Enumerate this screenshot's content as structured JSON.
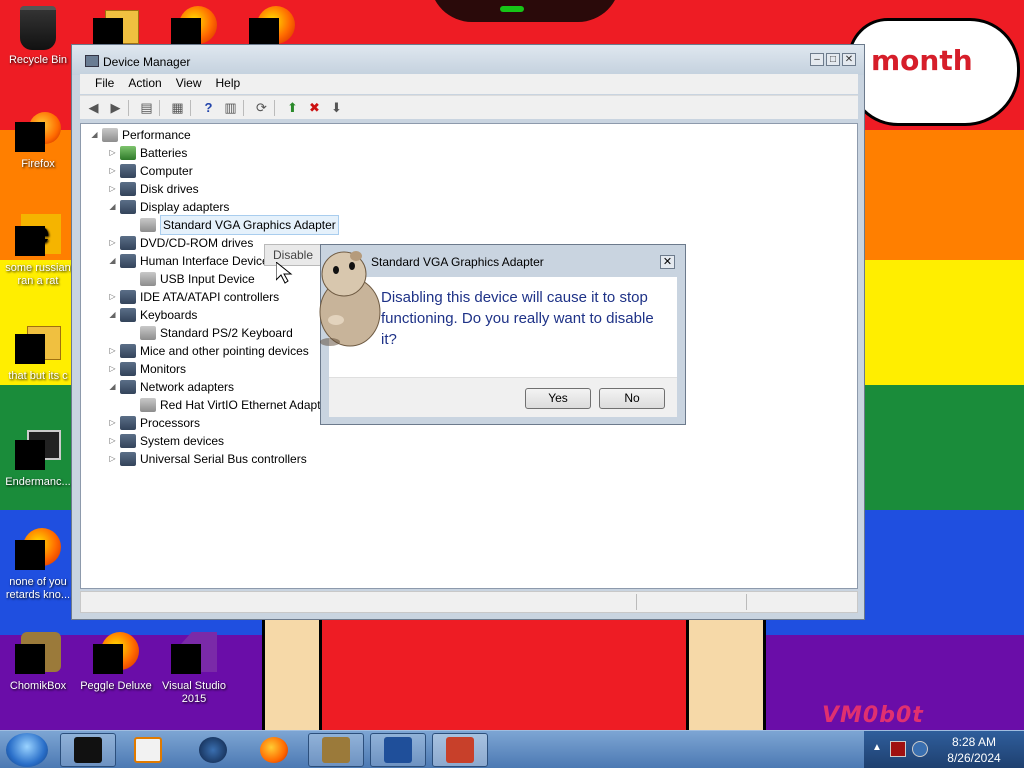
{
  "desktop": {
    "cloud_text": "month",
    "watermark": "VM0b0t",
    "icons": [
      {
        "label": "Recycle Bin",
        "icon": "recycle-bin-icon"
      },
      {
        "label": "Firefox",
        "icon": "firefox-icon"
      },
      {
        "label": "some russian ran a rat",
        "icon": "document-icon"
      },
      {
        "label": "that but its c",
        "icon": "folder-icon"
      },
      {
        "label": "Endermanc...",
        "icon": "app-icon"
      },
      {
        "label": "none of you retards kno...",
        "icon": "app-icon"
      },
      {
        "label": "ChomikBox",
        "icon": "chomikbox-icon"
      },
      {
        "label": "Peggle Deluxe",
        "icon": "peggle-icon"
      },
      {
        "label": "Visual Studio 2015",
        "icon": "visual-studio-icon"
      }
    ]
  },
  "window": {
    "title": "Device Manager",
    "menu": [
      "File",
      "Action",
      "View",
      "Help"
    ],
    "tree": {
      "root": "Performance",
      "items": [
        {
          "label": "Batteries",
          "indent": 1,
          "toggle": "▷"
        },
        {
          "label": "Computer",
          "indent": 1,
          "toggle": "▷"
        },
        {
          "label": "Disk drives",
          "indent": 1,
          "toggle": "▷"
        },
        {
          "label": "Display adapters",
          "indent": 1,
          "toggle": "◢"
        },
        {
          "label": "Standard VGA Graphics Adapter",
          "indent": 2,
          "toggle": "",
          "selected": true
        },
        {
          "label": "DVD/CD-ROM drives",
          "indent": 1,
          "toggle": "▷"
        },
        {
          "label": "Human Interface Devices",
          "indent": 1,
          "toggle": "◢"
        },
        {
          "label": "USB Input Device",
          "indent": 2,
          "toggle": ""
        },
        {
          "label": "IDE ATA/ATAPI controllers",
          "indent": 1,
          "toggle": "▷"
        },
        {
          "label": "Keyboards",
          "indent": 1,
          "toggle": "◢"
        },
        {
          "label": "Standard PS/2 Keyboard",
          "indent": 2,
          "toggle": ""
        },
        {
          "label": "Mice and other pointing devices",
          "indent": 1,
          "toggle": "▷"
        },
        {
          "label": "Monitors",
          "indent": 1,
          "toggle": "▷"
        },
        {
          "label": "Network adapters",
          "indent": 1,
          "toggle": "◢"
        },
        {
          "label": "Red Hat VirtIO Ethernet Adapter",
          "indent": 2,
          "toggle": ""
        },
        {
          "label": "Processors",
          "indent": 1,
          "toggle": "▷"
        },
        {
          "label": "System devices",
          "indent": 1,
          "toggle": "▷"
        },
        {
          "label": "Universal Serial Bus controllers",
          "indent": 1,
          "toggle": "▷"
        }
      ]
    }
  },
  "context_menu": {
    "item": "Disable"
  },
  "dialog": {
    "title": "Standard VGA Graphics Adapter",
    "message": "Disabling this device will cause it to stop functioning. Do you really want to disable it?",
    "yes": "Yes",
    "no": "No"
  },
  "taskbar": {
    "time": "8:28 AM",
    "date": "8/26/2024"
  },
  "colors": {
    "dialog_text": "#1e3287",
    "selection": "#e5f1fb"
  }
}
